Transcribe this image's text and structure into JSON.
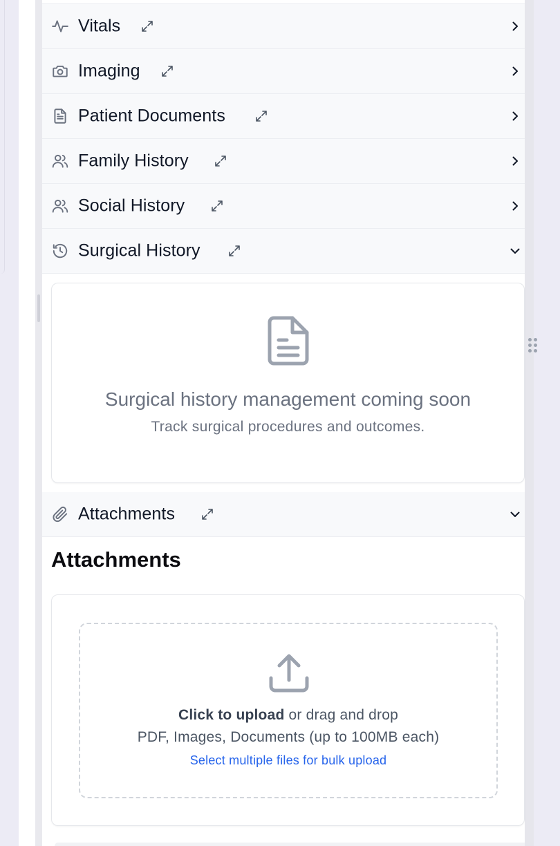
{
  "sections": [
    {
      "id": "vitals",
      "label": "Vitals",
      "icon": "activity-icon",
      "state": "collapsed"
    },
    {
      "id": "imaging",
      "label": "Imaging",
      "icon": "camera-icon",
      "state": "collapsed"
    },
    {
      "id": "patient-documents",
      "label": "Patient Documents",
      "icon": "document-icon",
      "state": "collapsed"
    },
    {
      "id": "family-history",
      "label": "Family History",
      "icon": "users-icon",
      "state": "collapsed"
    },
    {
      "id": "social-history",
      "label": "Social History",
      "icon": "users-icon",
      "state": "collapsed"
    },
    {
      "id": "surgical-history",
      "label": "Surgical History",
      "icon": "history-icon",
      "state": "expanded"
    },
    {
      "id": "attachments",
      "label": "Attachments",
      "icon": "paperclip-icon",
      "state": "expanded"
    }
  ],
  "surgical_history_panel": {
    "empty_title": "Surgical history management coming soon",
    "empty_subtitle": "Track surgical procedures and outcomes."
  },
  "attachments_panel": {
    "heading": "Attachments",
    "upload_strong": "Click to upload",
    "upload_rest": " or drag and drop",
    "file_types": "PDF, Images, Documents (up to 100MB each)",
    "bulk_link": "Select multiple files for bulk upload"
  },
  "colors": {
    "row_background": "#f8f9fb",
    "icon_gray": "#6b7280",
    "link_blue": "#2563eb",
    "text_dark": "#111827"
  }
}
